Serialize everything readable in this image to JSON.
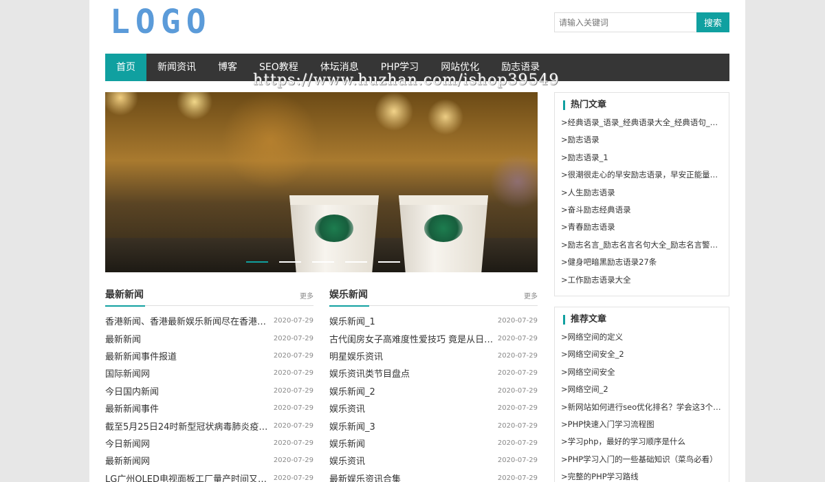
{
  "header": {
    "logo": "LOGO",
    "search_placeholder": "请输入关键词",
    "search_button": "搜索"
  },
  "nav": {
    "items": [
      "首页",
      "新闻资讯",
      "博客",
      "SEO教程",
      "体坛消息",
      "PHP学习",
      "网站优化",
      "励志语录"
    ]
  },
  "watermark": "https://www.huzhan.com/ishop39549",
  "banner": {
    "slide_count": 5,
    "active_slide": 1
  },
  "latest_news": {
    "title": "最新新闻",
    "more": "更多",
    "items": [
      {
        "title": "香港新闻、香港最新娱乐新闻尽在香港新...",
        "date": "2020-07-29"
      },
      {
        "title": "最新新闻",
        "date": "2020-07-29"
      },
      {
        "title": "最新新闻事件报道",
        "date": "2020-07-29"
      },
      {
        "title": "国际新闻网",
        "date": "2020-07-29"
      },
      {
        "title": "今日国内新闻",
        "date": "2020-07-29"
      },
      {
        "title": "最新新闻事件",
        "date": "2020-07-29"
      },
      {
        "title": "截至5月25日24时新型冠状病毒肺炎疫情...",
        "date": "2020-07-29"
      },
      {
        "title": "今日新闻网",
        "date": "2020-07-29"
      },
      {
        "title": "最新新闻网",
        "date": "2020-07-29"
      },
      {
        "title": "LG广州OLED电视面板工厂量产时间又延...",
        "date": "2020-07-29"
      }
    ]
  },
  "ent_news": {
    "title": "娱乐新闻",
    "more": "更多",
    "items": [
      {
        "title": "娱乐新闻_1",
        "date": "2020-07-29"
      },
      {
        "title": "古代闺房女子高难度性爱技巧 竟是从日本...",
        "date": "2020-07-29"
      },
      {
        "title": "明星娱乐资讯",
        "date": "2020-07-29"
      },
      {
        "title": "娱乐资讯类节目盘点",
        "date": "2020-07-29"
      },
      {
        "title": "娱乐新闻_2",
        "date": "2020-07-29"
      },
      {
        "title": "娱乐资讯",
        "date": "2020-07-29"
      },
      {
        "title": "娱乐新闻_3",
        "date": "2020-07-29"
      },
      {
        "title": "娱乐新闻",
        "date": "2020-07-29"
      },
      {
        "title": "娱乐资讯",
        "date": "2020-07-29"
      },
      {
        "title": "最新娱乐资讯合集",
        "date": "2020-07-29"
      }
    ]
  },
  "hot": {
    "title": "热门文章",
    "items": [
      ">经典语录_语录_经典语录大全_经典语句_经...",
      ">励志语录",
      ">励志语录_1",
      ">很潮很走心的早安励志语录，早安正能量满...",
      ">人生励志语录",
      ">奋斗励志经典语录",
      ">青春励志语录",
      ">励志名言_励志名言名句大全_励志名言警句_...",
      ">健身吧暗黑励志语录27条",
      ">工作励志语录大全"
    ]
  },
  "recommend": {
    "title": "推荐文章",
    "items": [
      ">网络空间的定义",
      ">网络空间安全_2",
      ">网络空间安全",
      ">网络空间_2",
      ">新网站如何进行seo优化排名？学会这3个方...",
      ">PHP快速入门学习流程图",
      ">学习php，最好的学习顺序是什么",
      ">PHP学习入门的一些基础知识（菜鸟必看）",
      ">完整的PHP学习路线"
    ]
  },
  "colors": {
    "accent": "#10a0a0",
    "nav_bg": "#363636",
    "logo": "#5b9bd9"
  }
}
